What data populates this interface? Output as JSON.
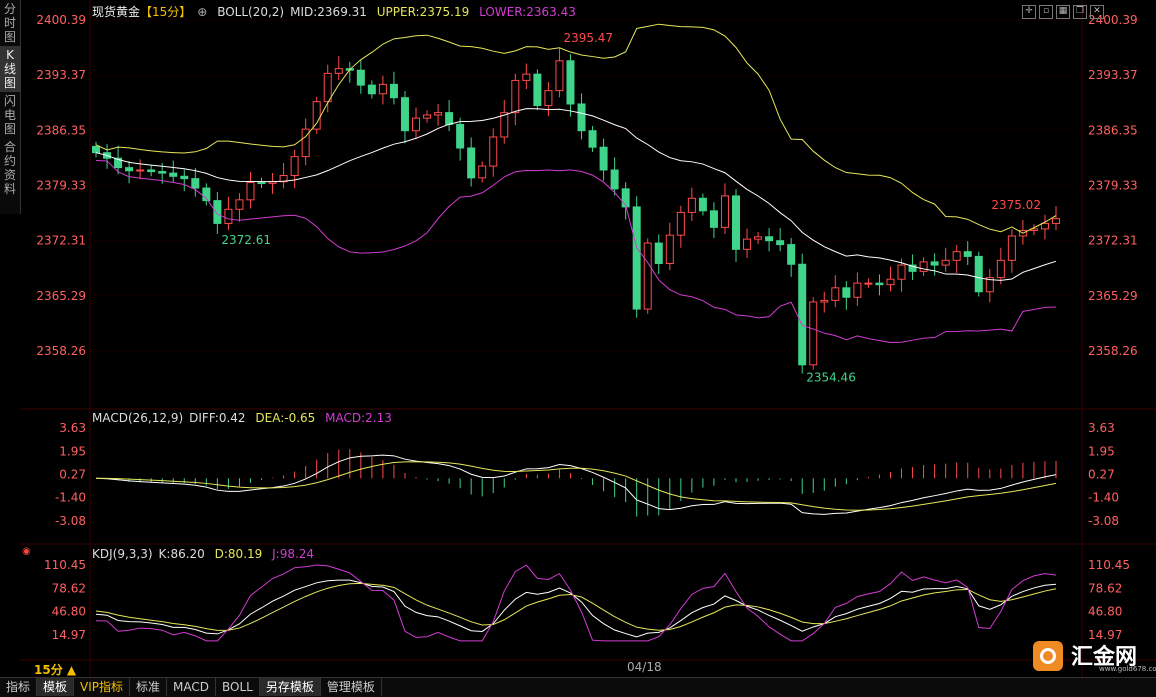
{
  "sidebar": {
    "tabs": [
      {
        "label": "分\n时\n图",
        "active": false
      },
      {
        "label": "K\n线\n图",
        "active": true
      },
      {
        "label": "闪\n电\n图",
        "active": false
      },
      {
        "label": "合\n约\n资\n料",
        "active": false
      }
    ]
  },
  "main": {
    "title": "现货黄金",
    "period_tag": "【15分】",
    "boll": {
      "label": "BOLL(20,2)",
      "mid": "MID:2369.31",
      "upper": "UPPER:2375.19",
      "lower": "LOWER:2363.43"
    },
    "price_ticks": [
      "2400.39",
      "2393.37",
      "2386.35",
      "2379.33",
      "2372.31",
      "2365.29",
      "2358.26"
    ],
    "annotations": {
      "high": "2395.47",
      "low_left": "2372.61",
      "low": "2354.46",
      "recent_high": "2375.02"
    }
  },
  "macd": {
    "label": "MACD(26,12,9)",
    "diff": "DIFF:0.42",
    "dea": "DEA:-0.65",
    "macd": "MACD:2.13",
    "ticks": [
      "3.63",
      "1.95",
      "0.27",
      "-1.40",
      "-3.08"
    ]
  },
  "kdj": {
    "label": "KDJ(9,3,3)",
    "k": "K:86.20",
    "d": "D:80.19",
    "j": "J:98.24",
    "ticks": [
      "110.45",
      "78.62",
      "46.80",
      "14.97"
    ]
  },
  "period_label": "15分 ▲",
  "date_label": "04/18",
  "bottom_tabs": [
    {
      "label": "指标",
      "active": false
    },
    {
      "label": "模板",
      "active": true
    },
    {
      "label": "VIP指标",
      "active": false,
      "vip": true
    },
    {
      "label": "标准",
      "active": false
    },
    {
      "label": "MACD",
      "active": false
    },
    {
      "label": "BOLL",
      "active": false
    },
    {
      "label": "另存模板",
      "active": true
    },
    {
      "label": "管理模板",
      "active": false
    }
  ],
  "logo": {
    "name": "汇金网",
    "url": "www.gold678.com"
  },
  "colors": {
    "up": "#ff4a4a",
    "down": "#3fd48a",
    "mid": "#ffffff",
    "upper": "#e6e65a",
    "lower": "#d23cd2",
    "grid": "#3a0000",
    "axis_text": "#ff6060",
    "kline_text": "#cccccc"
  },
  "chart_data": {
    "type": "candlestick",
    "closes": [
      2383.5,
      2382.8,
      2381.6,
      2381.2,
      2381.3,
      2381.1,
      2380.9,
      2380.5,
      2380.2,
      2379.0,
      2377.4,
      2374.5,
      2376.3,
      2377.5,
      2379.7,
      2379.6,
      2379.8,
      2380.6,
      2383.0,
      2386.5,
      2390.0,
      2393.6,
      2394.2,
      2394.0,
      2392.1,
      2391.0,
      2392.2,
      2390.5,
      2386.3,
      2387.9,
      2388.3,
      2388.6,
      2387.1,
      2384.1,
      2380.3,
      2381.8,
      2385.5,
      2388.6,
      2392.7,
      2393.5,
      2389.5,
      2391.4,
      2395.2,
      2389.7,
      2386.3,
      2384.2,
      2381.3,
      2378.9,
      2376.6,
      2363.6,
      2372.0,
      2369.4,
      2373.0,
      2375.9,
      2377.7,
      2376.1,
      2374.0,
      2378.0,
      2371.2,
      2372.5,
      2372.8,
      2372.3,
      2371.8,
      2369.3,
      2356.5,
      2364.5,
      2364.7,
      2366.3,
      2365.1,
      2366.9,
      2366.9,
      2366.7,
      2367.4,
      2369.2,
      2368.4,
      2369.6,
      2369.2,
      2369.8,
      2370.9,
      2370.3,
      2365.8,
      2367.6,
      2369.8,
      2372.9,
      2373.6,
      2373.8,
      2374.5,
      2375.1
    ],
    "ylim": [
      2354.46,
      2400.39
    ]
  }
}
